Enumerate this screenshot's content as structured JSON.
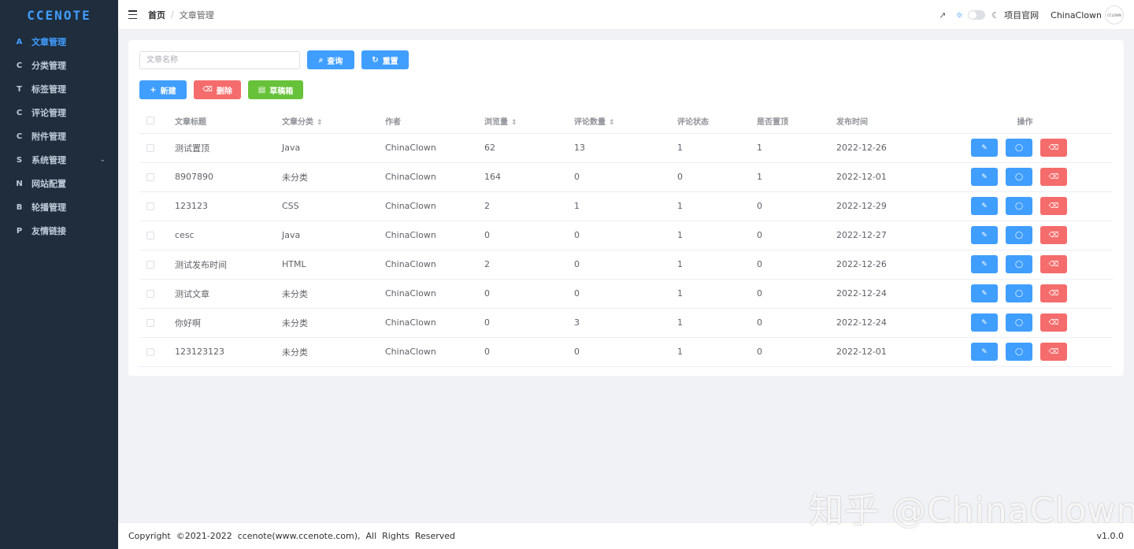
{
  "app": {
    "logo": "CCENOTE"
  },
  "sidebar": {
    "items": [
      {
        "label": "文章管理",
        "icon": "A",
        "active": true
      },
      {
        "label": "分类管理",
        "icon": "C"
      },
      {
        "label": "标签管理",
        "icon": "T"
      },
      {
        "label": "评论管理",
        "icon": "C"
      },
      {
        "label": "附件管理",
        "icon": "C"
      },
      {
        "label": "系统管理",
        "icon": "S",
        "chevron": "⌄"
      },
      {
        "label": "网站配置",
        "icon": "N"
      },
      {
        "label": "轮播管理",
        "icon": "B"
      },
      {
        "label": "友情链接",
        "icon": "P"
      }
    ]
  },
  "header": {
    "breadcrumb_home": "首页",
    "breadcrumb_sep": "/",
    "breadcrumb_current": "文章管理",
    "project_link": "项目官网",
    "username": "ChinaClown",
    "avatar_text": "CCLOWN"
  },
  "toolbar": {
    "search_placeholder": "文章名称",
    "query_label": "查询",
    "reset_label": "重置",
    "new_label": "新建",
    "delete_label": "删除",
    "drafts_label": "草稿箱"
  },
  "table": {
    "columns": [
      "文章标题",
      "文章分类",
      "作者",
      "浏览量",
      "评论数量",
      "评论状态",
      "是否置顶",
      "发布时间",
      "操作"
    ],
    "rows": [
      {
        "title": "测试置顶",
        "category": "Java",
        "author": "ChinaClown",
        "views": "62",
        "comments": "13",
        "comment_status": "1",
        "pinned": "1",
        "date": "2022-12-26"
      },
      {
        "title": "8907890",
        "category": "未分类",
        "author": "ChinaClown",
        "views": "164",
        "comments": "0",
        "comment_status": "0",
        "pinned": "1",
        "date": "2022-12-01"
      },
      {
        "title": "123123",
        "category": "CSS",
        "author": "ChinaClown",
        "views": "2",
        "comments": "1",
        "comment_status": "1",
        "pinned": "0",
        "date": "2022-12-29"
      },
      {
        "title": "cesc",
        "category": "Java",
        "author": "ChinaClown",
        "views": "0",
        "comments": "0",
        "comment_status": "1",
        "pinned": "0",
        "date": "2022-12-27"
      },
      {
        "title": "测试发布时间",
        "category": "HTML",
        "author": "ChinaClown",
        "views": "2",
        "comments": "0",
        "comment_status": "1",
        "pinned": "0",
        "date": "2022-12-26"
      },
      {
        "title": "测试文章",
        "category": "未分类",
        "author": "ChinaClown",
        "views": "0",
        "comments": "0",
        "comment_status": "1",
        "pinned": "0",
        "date": "2022-12-24"
      },
      {
        "title": "你好啊",
        "category": "未分类",
        "author": "ChinaClown",
        "views": "0",
        "comments": "3",
        "comment_status": "1",
        "pinned": "0",
        "date": "2022-12-24"
      },
      {
        "title": "123123123",
        "category": "未分类",
        "author": "ChinaClown",
        "views": "0",
        "comments": "0",
        "comment_status": "1",
        "pinned": "0",
        "date": "2022-12-01"
      }
    ]
  },
  "footer": {
    "copyright": "Copyright  ©2021-2022  ccenote(www.ccenote.com),  All  Rights  Reserved",
    "version": "v1.0.0"
  },
  "watermark": "知乎 @ChinaClown",
  "colors": {
    "primary": "#409eff",
    "danger": "#f56c6c",
    "success": "#67c23a",
    "sidebar_bg": "#1f2d3d"
  },
  "icons": {
    "expand": "↗",
    "sun": "☼",
    "moon": "☾",
    "search": "⌕",
    "refresh": "↻",
    "plus": "+",
    "trash": "🗑",
    "file": "▤",
    "edit": "✎",
    "comment": "◯",
    "sort": "⇕"
  }
}
